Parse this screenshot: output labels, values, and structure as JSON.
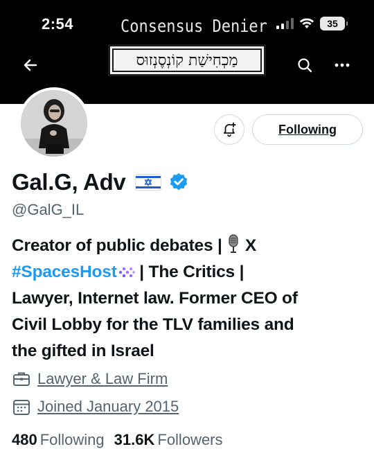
{
  "status_bar": {
    "time": "2:54",
    "battery": "35"
  },
  "banner": {
    "title": "Consensus Denier",
    "hebrew_text": "מַכְחִישַׁת קוֹנְסֶנְזוּס"
  },
  "header": {
    "back_icon": "back-arrow-icon",
    "search_icon": "search-icon",
    "more_icon": "more-icon"
  },
  "profile": {
    "display_name": "Gal.G, Adv",
    "flag": "🇮🇱",
    "handle": "@GalG_IL",
    "following_button": "Following",
    "bio": {
      "line1": "Creator of public debates | ",
      "line1_end": " X",
      "hashtag": "#SpacesHost",
      "line2_rest": " | The Critics |",
      "line3": "Lawyer, Internet law. Former CEO of",
      "line4": "Civil Lobby for the TLV families and",
      "line5": "the gifted in Israel"
    },
    "category": "Lawyer & Law Firm",
    "joined": "Joined January 2015",
    "following_count": "480",
    "following_label": "Following",
    "followers_count": "31.6K",
    "followers_label": "Followers"
  },
  "colors": {
    "accent": "#1d9bf0",
    "secondary_text": "#536471",
    "banner_bg": "#000000"
  }
}
